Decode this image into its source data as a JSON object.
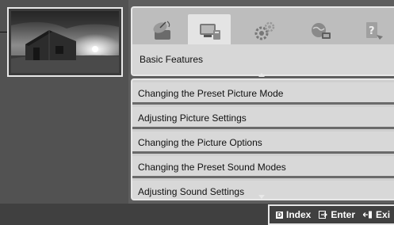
{
  "menu": {
    "section_title": "Basic Features",
    "tabs": [
      {
        "icon": "satellite-dish-icon",
        "active": false
      },
      {
        "icon": "tv-stand-icon",
        "active": true
      },
      {
        "icon": "gears-icon",
        "active": false
      },
      {
        "icon": "globe-network-icon",
        "active": false
      },
      {
        "icon": "help-question-icon",
        "active": false
      }
    ],
    "items": [
      {
        "label": "Changing the Preset Picture Mode"
      },
      {
        "label": "Adjusting Picture Settings"
      },
      {
        "label": "Changing the Picture Options"
      },
      {
        "label": "Changing the Preset Sound Modes"
      },
      {
        "label": "Adjusting Sound Settings"
      }
    ]
  },
  "footer": {
    "index_key": "D",
    "index_label": "Index",
    "enter_label": "Enter",
    "exit_label": "Exi"
  },
  "colors": {
    "background": "#5e5e5e",
    "panel": "#bdbdbd",
    "list_item": "#d8d8d8",
    "active_tab": "#e4e4e4",
    "border": "#e8e8e8"
  }
}
